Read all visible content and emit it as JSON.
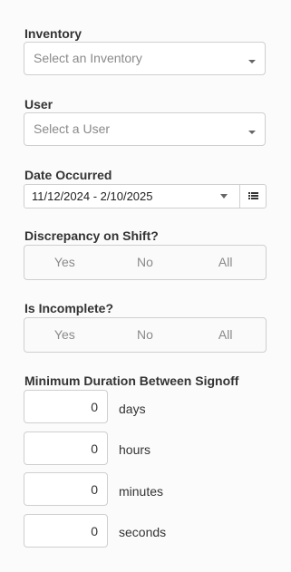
{
  "inventory": {
    "label": "Inventory",
    "placeholder": "Select an Inventory"
  },
  "user": {
    "label": "User",
    "placeholder": "Select a User"
  },
  "date_occurred": {
    "label": "Date Occurred",
    "value": "11/12/2024 - 2/10/2025",
    "list_icon": "list-icon"
  },
  "discrepancy": {
    "label": "Discrepancy on Shift?",
    "options": [
      "Yes",
      "No",
      "All"
    ]
  },
  "incomplete": {
    "label": "Is Incomplete?",
    "options": [
      "Yes",
      "No",
      "All"
    ]
  },
  "min_duration": {
    "label": "Minimum Duration Between Signoff",
    "fields": [
      {
        "value": "0",
        "unit": "days"
      },
      {
        "value": "0",
        "unit": "hours"
      },
      {
        "value": "0",
        "unit": "minutes"
      },
      {
        "value": "0",
        "unit": "seconds"
      }
    ]
  },
  "colors": {
    "border": "#cfcfcf",
    "placeholder": "#8a8a8a",
    "text": "#333333",
    "background": "#fbfbfb"
  }
}
